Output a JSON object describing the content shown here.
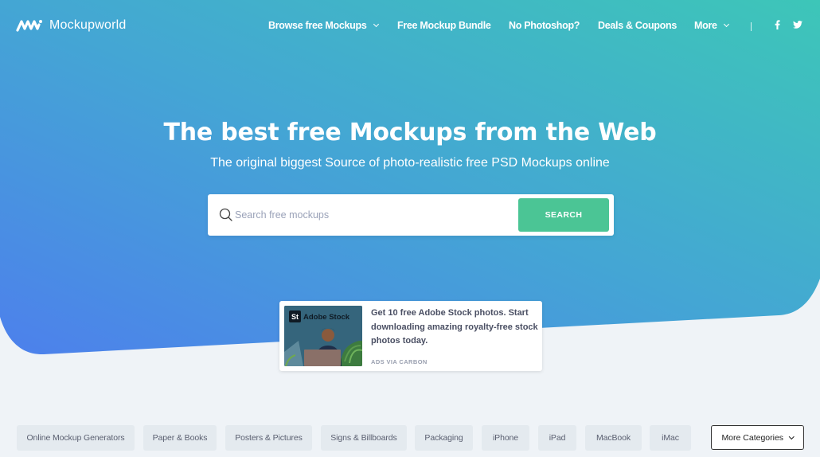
{
  "brand": {
    "name": "Mockupworld"
  },
  "nav": {
    "items": [
      {
        "label": "Browse free Mockups",
        "has_dropdown": true
      },
      {
        "label": "Free Mockup Bundle",
        "has_dropdown": false
      },
      {
        "label": "No Photoshop?",
        "has_dropdown": false
      },
      {
        "label": "Deals & Coupons",
        "has_dropdown": false
      },
      {
        "label": "More",
        "has_dropdown": true
      }
    ],
    "social": {
      "facebook": "f",
      "twitter": "twitter-icon"
    }
  },
  "hero": {
    "title": "The best free Mockups from the Web",
    "subtitle": "The original biggest Source of photo-realistic free PSD Mockups online",
    "gradient": {
      "from": "#4d82ea",
      "to": "#3dc4b9"
    }
  },
  "search": {
    "placeholder": "Search free mockups",
    "value": "",
    "button_label": "SEARCH",
    "button_color": "#4bc595"
  },
  "ad": {
    "image_badge": "St",
    "image_brand": "Adobe Stock",
    "text": "Get 10 free Adobe Stock photos. Start downloading amazing royalty-free stock photos today.",
    "via": "ADS VIA CARBON"
  },
  "categories": {
    "items": [
      "Online Mockup Generators",
      "Paper & Books",
      "Posters & Pictures",
      "Signs & Billboards",
      "Packaging",
      "iPhone",
      "iPad",
      "MacBook",
      "iMac"
    ],
    "more_label": "More Categories"
  }
}
